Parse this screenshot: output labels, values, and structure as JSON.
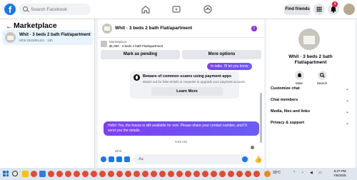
{
  "topbar": {
    "logo": "f",
    "search_placeholder": "Search Facebook",
    "find_friends": "Find friends",
    "notification_count": "4"
  },
  "sidebar": {
    "back": "←",
    "title": "Marketplace",
    "item": {
      "title": "Whit · 3 beds 2 bath Flat/apartment",
      "sub": "Whit 3343991401 · 15h"
    }
  },
  "chat": {
    "title": "Whit · 3 beds 2 bath Flat/apartment",
    "info_icon": "i",
    "marketplace_label": "Marketplace",
    "listing": "$1,000 · 3 beds 2 bath Flat/apartment",
    "mark_pending": "Mark as pending",
    "more_options": "More options",
    "msg_partial": "In talks. I'll let you know.",
    "scam_title": "Beware of common scams using payment apps",
    "scam_text": "Watch out for fake emails or requests to upgrade your payment account.",
    "learn_more": "Learn More",
    "msg_out": "Hello! Yes, the house is still available for rent. Please share your contact number, and I'll send you the details .",
    "timestamp": "6:53 AM",
    "sender": "Whit",
    "msg_in": "3343991401",
    "composer_placeholder": "Aa",
    "like": "👍"
  },
  "right": {
    "title": "Whit · 3 beds 2 bath Flat/apartment",
    "mute": "Mute",
    "search": "Search",
    "items": [
      "Customize chat",
      "Chat members",
      "Media, files and links",
      "Privacy & support"
    ],
    "chevron": "⌄"
  },
  "taskbar": {
    "weather": "39°C",
    "time": "6:27 PM",
    "date": "7/6/2025"
  },
  "colors": {
    "brand": "#1877f2",
    "gradient_start": "#7e3ff2",
    "gradient_end": "#6a5cf5",
    "badge": "#e41e3f"
  }
}
